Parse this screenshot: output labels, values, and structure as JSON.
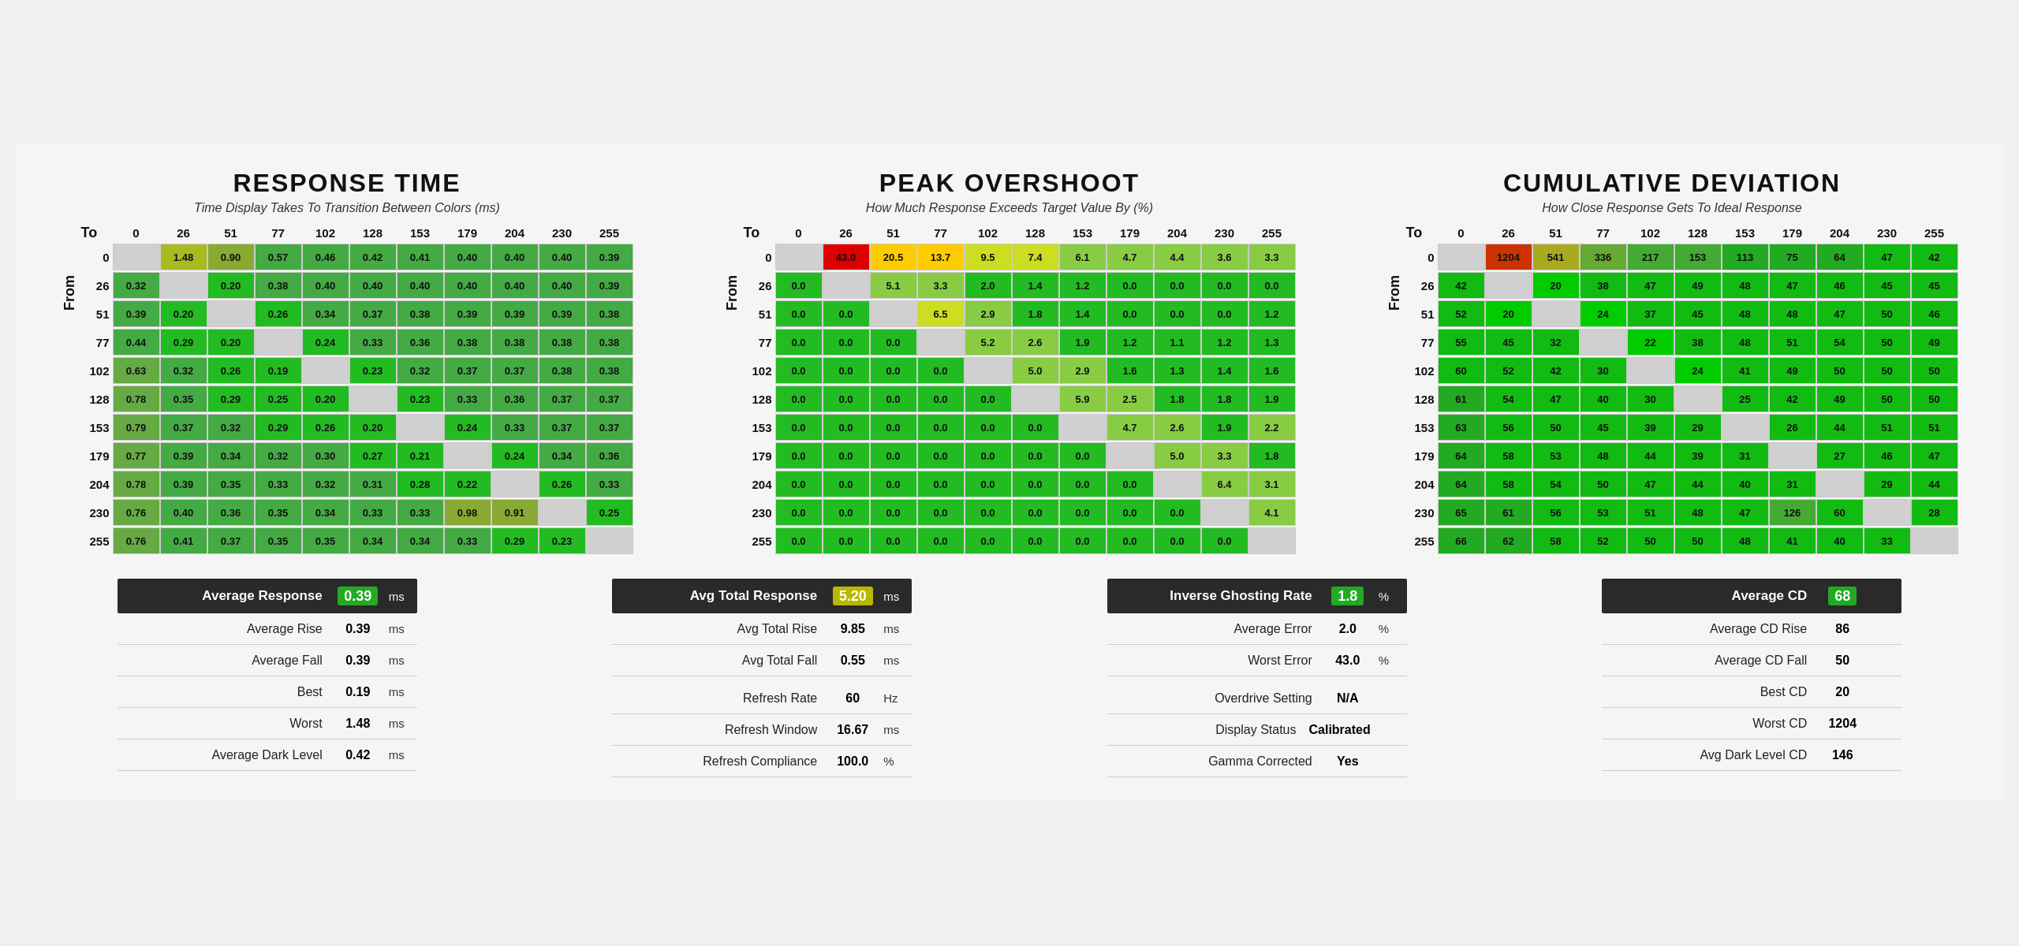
{
  "sections": {
    "response_time": {
      "title": "RESPONSE TIME",
      "subtitle": "Time Display Takes To Transition Between Colors (ms)",
      "from_label": "From",
      "to_label": "To",
      "headers": [
        "",
        "0",
        "26",
        "51",
        "77",
        "102",
        "128",
        "153",
        "179",
        "204",
        "230",
        "255"
      ],
      "rows": [
        {
          "label": "0",
          "cells": [
            "",
            "1.48",
            "0.90",
            "0.57",
            "0.46",
            "0.42",
            "0.41",
            "0.40",
            "0.40",
            "0.40",
            "0.39"
          ]
        },
        {
          "label": "26",
          "cells": [
            "0.32",
            "",
            "0.20",
            "0.38",
            "0.40",
            "0.40",
            "0.40",
            "0.40",
            "0.40",
            "0.40",
            "0.39"
          ]
        },
        {
          "label": "51",
          "cells": [
            "0.39",
            "0.20",
            "",
            "0.26",
            "0.34",
            "0.37",
            "0.38",
            "0.39",
            "0.39",
            "0.39",
            "0.38"
          ]
        },
        {
          "label": "77",
          "cells": [
            "0.44",
            "0.29",
            "0.20",
            "",
            "0.24",
            "0.33",
            "0.36",
            "0.38",
            "0.38",
            "0.38",
            "0.38"
          ]
        },
        {
          "label": "102",
          "cells": [
            "0.63",
            "0.32",
            "0.26",
            "0.19",
            "",
            "0.23",
            "0.32",
            "0.37",
            "0.37",
            "0.38",
            "0.38"
          ]
        },
        {
          "label": "128",
          "cells": [
            "0.78",
            "0.35",
            "0.29",
            "0.25",
            "0.20",
            "",
            "0.23",
            "0.33",
            "0.36",
            "0.37",
            "0.37"
          ]
        },
        {
          "label": "153",
          "cells": [
            "0.79",
            "0.37",
            "0.32",
            "0.29",
            "0.26",
            "0.20",
            "",
            "0.24",
            "0.33",
            "0.37",
            "0.37"
          ]
        },
        {
          "label": "179",
          "cells": [
            "0.77",
            "0.39",
            "0.34",
            "0.32",
            "0.30",
            "0.27",
            "0.21",
            "",
            "0.24",
            "0.34",
            "0.36"
          ]
        },
        {
          "label": "204",
          "cells": [
            "0.78",
            "0.39",
            "0.35",
            "0.33",
            "0.32",
            "0.31",
            "0.28",
            "0.22",
            "",
            "0.26",
            "0.33"
          ]
        },
        {
          "label": "230",
          "cells": [
            "0.76",
            "0.40",
            "0.36",
            "0.35",
            "0.34",
            "0.33",
            "0.33",
            "0.98",
            "0.91",
            "",
            "0.25"
          ]
        },
        {
          "label": "255",
          "cells": [
            "0.76",
            "0.41",
            "0.37",
            "0.35",
            "0.35",
            "0.34",
            "0.34",
            "0.33",
            "0.29",
            "0.23",
            ""
          ]
        }
      ]
    },
    "peak_overshoot": {
      "title": "PEAK OVERSHOOT",
      "subtitle": "How Much Response Exceeds Target Value By (%)",
      "from_label": "From",
      "to_label": "To",
      "headers": [
        "",
        "0",
        "26",
        "51",
        "77",
        "102",
        "128",
        "153",
        "179",
        "204",
        "230",
        "255"
      ],
      "rows": [
        {
          "label": "0",
          "cells": [
            "",
            "43.0",
            "20.5",
            "13.7",
            "9.5",
            "7.4",
            "6.1",
            "4.7",
            "4.4",
            "3.6",
            "3.3"
          ]
        },
        {
          "label": "26",
          "cells": [
            "0.0",
            "",
            "5.1",
            "3.3",
            "2.0",
            "1.4",
            "1.2",
            "0.0",
            "0.0",
            "0.0",
            "0.0"
          ]
        },
        {
          "label": "51",
          "cells": [
            "0.0",
            "0.0",
            "",
            "6.5",
            "2.9",
            "1.8",
            "1.4",
            "0.0",
            "0.0",
            "0.0",
            "1.2"
          ]
        },
        {
          "label": "77",
          "cells": [
            "0.0",
            "0.0",
            "0.0",
            "",
            "5.2",
            "2.6",
            "1.9",
            "1.2",
            "1.1",
            "1.2",
            "1.3"
          ]
        },
        {
          "label": "102",
          "cells": [
            "0.0",
            "0.0",
            "0.0",
            "0.0",
            "",
            "5.0",
            "2.9",
            "1.6",
            "1.3",
            "1.4",
            "1.6"
          ]
        },
        {
          "label": "128",
          "cells": [
            "0.0",
            "0.0",
            "0.0",
            "0.0",
            "0.0",
            "",
            "5.9",
            "2.5",
            "1.8",
            "1.8",
            "1.9"
          ]
        },
        {
          "label": "153",
          "cells": [
            "0.0",
            "0.0",
            "0.0",
            "0.0",
            "0.0",
            "0.0",
            "",
            "4.7",
            "2.6",
            "1.9",
            "2.2"
          ]
        },
        {
          "label": "179",
          "cells": [
            "0.0",
            "0.0",
            "0.0",
            "0.0",
            "0.0",
            "0.0",
            "0.0",
            "",
            "5.0",
            "3.3",
            "1.8"
          ]
        },
        {
          "label": "204",
          "cells": [
            "0.0",
            "0.0",
            "0.0",
            "0.0",
            "0.0",
            "0.0",
            "0.0",
            "0.0",
            "",
            "6.4",
            "3.1"
          ]
        },
        {
          "label": "230",
          "cells": [
            "0.0",
            "0.0",
            "0.0",
            "0.0",
            "0.0",
            "0.0",
            "0.0",
            "0.0",
            "0.0",
            "",
            "4.1"
          ]
        },
        {
          "label": "255",
          "cells": [
            "0.0",
            "0.0",
            "0.0",
            "0.0",
            "0.0",
            "0.0",
            "0.0",
            "0.0",
            "0.0",
            "0.0",
            ""
          ]
        }
      ]
    },
    "cumulative_deviation": {
      "title": "CUMULATIVE DEVIATION",
      "subtitle": "How Close Response Gets To Ideal Response",
      "from_label": "From",
      "to_label": "To",
      "headers": [
        "",
        "0",
        "26",
        "51",
        "77",
        "102",
        "128",
        "153",
        "179",
        "204",
        "230",
        "255"
      ],
      "rows": [
        {
          "label": "0",
          "cells": [
            "",
            "1204",
            "541",
            "336",
            "217",
            "153",
            "113",
            "75",
            "64",
            "47",
            "42"
          ]
        },
        {
          "label": "26",
          "cells": [
            "42",
            "",
            "20",
            "38",
            "47",
            "49",
            "48",
            "47",
            "46",
            "45",
            "45"
          ]
        },
        {
          "label": "51",
          "cells": [
            "52",
            "20",
            "",
            "24",
            "37",
            "45",
            "48",
            "48",
            "47",
            "50",
            "46"
          ]
        },
        {
          "label": "77",
          "cells": [
            "55",
            "45",
            "32",
            "",
            "22",
            "38",
            "48",
            "51",
            "54",
            "50",
            "49"
          ]
        },
        {
          "label": "102",
          "cells": [
            "60",
            "52",
            "42",
            "30",
            "",
            "24",
            "41",
            "49",
            "50",
            "50",
            "50"
          ]
        },
        {
          "label": "128",
          "cells": [
            "61",
            "54",
            "47",
            "40",
            "30",
            "",
            "25",
            "42",
            "49",
            "50",
            "50"
          ]
        },
        {
          "label": "153",
          "cells": [
            "63",
            "56",
            "50",
            "45",
            "39",
            "29",
            "",
            "26",
            "44",
            "51",
            "51"
          ]
        },
        {
          "label": "179",
          "cells": [
            "64",
            "58",
            "53",
            "48",
            "44",
            "39",
            "31",
            "",
            "27",
            "46",
            "47"
          ]
        },
        {
          "label": "204",
          "cells": [
            "64",
            "58",
            "54",
            "50",
            "47",
            "44",
            "40",
            "31",
            "",
            "29",
            "44"
          ]
        },
        {
          "label": "230",
          "cells": [
            "65",
            "61",
            "56",
            "53",
            "51",
            "48",
            "47",
            "126",
            "60",
            "",
            "28"
          ]
        },
        {
          "label": "255",
          "cells": [
            "66",
            "62",
            "58",
            "52",
            "50",
            "50",
            "48",
            "41",
            "40",
            "33",
            ""
          ]
        }
      ]
    }
  },
  "stats": {
    "response_time": {
      "header_label": "Average Response",
      "header_value": "0.39",
      "header_unit": "ms",
      "header_highlight": "green",
      "items": [
        {
          "label": "Average Rise",
          "value": "0.39",
          "unit": "ms"
        },
        {
          "label": "Average Fall",
          "value": "0.39",
          "unit": "ms"
        },
        {
          "label": "Best",
          "value": "0.19",
          "unit": "ms"
        },
        {
          "label": "Worst",
          "value": "1.48",
          "unit": "ms"
        },
        {
          "label": "Average Dark Level",
          "value": "0.42",
          "unit": "ms"
        }
      ]
    },
    "avg_total": {
      "header_label": "Avg Total Response",
      "header_value": "5.20",
      "header_unit": "ms",
      "header_highlight": "yellow",
      "items": [
        {
          "label": "Avg Total Rise",
          "value": "9.85",
          "unit": "ms"
        },
        {
          "label": "Avg Total Fall",
          "value": "0.55",
          "unit": "ms"
        },
        {
          "label": "",
          "value": "",
          "unit": ""
        },
        {
          "label": "Refresh Rate",
          "value": "60",
          "unit": "Hz"
        },
        {
          "label": "Refresh Window",
          "value": "16.67",
          "unit": "ms"
        },
        {
          "label": "Refresh Compliance",
          "value": "100.0",
          "unit": "%"
        }
      ]
    },
    "ghosting": {
      "header_label": "Inverse Ghosting Rate",
      "header_value": "1.8",
      "header_unit": "%",
      "header_highlight": "green",
      "items": [
        {
          "label": "Average Error",
          "value": "2.0",
          "unit": "%"
        },
        {
          "label": "Worst Error",
          "value": "43.0",
          "unit": "%"
        },
        {
          "label": "",
          "value": "",
          "unit": ""
        },
        {
          "label": "Overdrive Setting",
          "value": "N/A",
          "unit": ""
        },
        {
          "label": "Display Status",
          "value": "Calibrated",
          "unit": ""
        },
        {
          "label": "Gamma Corrected",
          "value": "Yes",
          "unit": ""
        }
      ]
    },
    "cumulative": {
      "header_label": "Average CD",
      "header_value": "68",
      "header_unit": "",
      "header_highlight": "green",
      "items": [
        {
          "label": "Average CD Rise",
          "value": "86",
          "unit": ""
        },
        {
          "label": "Average CD Fall",
          "value": "50",
          "unit": ""
        },
        {
          "label": "Best CD",
          "value": "20",
          "unit": ""
        },
        {
          "label": "Worst CD",
          "value": "1204",
          "unit": ""
        },
        {
          "label": "Avg Dark Level CD",
          "value": "146",
          "unit": ""
        }
      ]
    }
  }
}
